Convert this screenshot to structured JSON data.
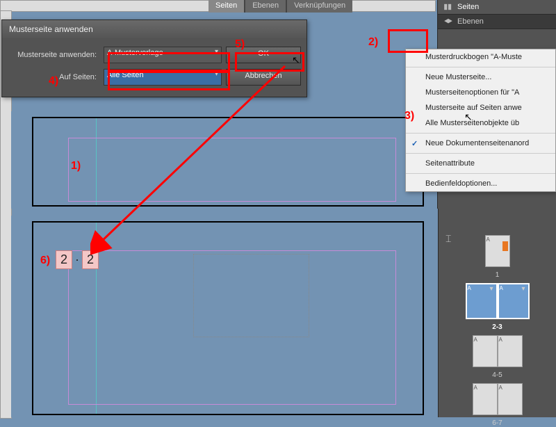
{
  "tabs": {
    "t1": "Seiten",
    "t2": "Ebenen",
    "t3": "Verknüpfungen"
  },
  "dialog": {
    "title": "Musterseite anwenden",
    "lbl1": "Musterseite anwenden:",
    "val1": "A-Mustervorlage",
    "lbl2": "Auf Seiten:",
    "val2": "Alle Seiten",
    "ok": "OK",
    "cancel": "Abbrechen"
  },
  "panel": {
    "p1": "Seiten",
    "p2": "Ebenen"
  },
  "ctx": {
    "i1": "Musterdruckbogen \"A-Muste",
    "i2": "Neue Musterseite...",
    "i3": "Musterseitenoptionen für \"A",
    "i4": "Musterseite auf Seiten anwe",
    "i5": "Alle Musterseitenobjekte üb",
    "i6": "Neue Dokumentenseitenanord",
    "i7": "Seitenattribute",
    "i8": "Bedienfeldoptionen..."
  },
  "steps": {
    "s1": "1)",
    "s2": "2)",
    "s3": "3)",
    "s4": "4)",
    "s5": "5)",
    "s6": "6)"
  },
  "spreads": {
    "l1": "1",
    "l2": "2-3",
    "l3": "4-5",
    "l4": "6-7"
  },
  "result": {
    "a": "2",
    "b": "2"
  },
  "chart_data": null
}
